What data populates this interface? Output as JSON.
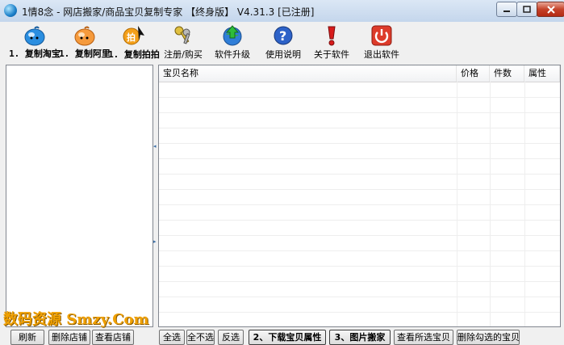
{
  "window": {
    "title": "1情8念  - 网店搬家/商品宝贝复制专家 【终身版】 V4.31.3 [已注册]"
  },
  "toolbar": {
    "items": [
      {
        "label": "1. 复制淘宝",
        "icon": "taobao-mascot-icon"
      },
      {
        "label": "1. 复制阿里",
        "icon": "alibaba-mascot-icon"
      },
      {
        "label": "1. 复制拍拍",
        "icon": "paipai-icon"
      },
      {
        "label": "注册/购买",
        "icon": "keys-icon"
      },
      {
        "label": "软件升级",
        "icon": "upgrade-globe-icon"
      },
      {
        "label": "使用说明",
        "icon": "help-icon"
      },
      {
        "label": "关于软件",
        "icon": "about-icon"
      },
      {
        "label": "退出软件",
        "icon": "power-icon"
      }
    ]
  },
  "grid": {
    "columns": [
      "宝贝名称",
      "价格",
      "件数",
      "属性"
    ]
  },
  "watermark": {
    "text": "数码资源 Smzy.Com"
  },
  "bottom_left": {
    "refresh": "刷新",
    "delete_shop": "删除店铺",
    "view_shop": "查看店铺"
  },
  "bottom_right": {
    "select_all": "全选",
    "select_none": "全不选",
    "invert": "反选",
    "download_props": "2、下载宝贝属性",
    "move_images": "3、图片搬家",
    "view_selected": "查看所选宝贝",
    "delete_checked": "删除勾选的宝贝"
  },
  "colors": {
    "titlebar": "#c4d6ec",
    "close_button": "#c5432a",
    "watermark": "#f0a000"
  }
}
